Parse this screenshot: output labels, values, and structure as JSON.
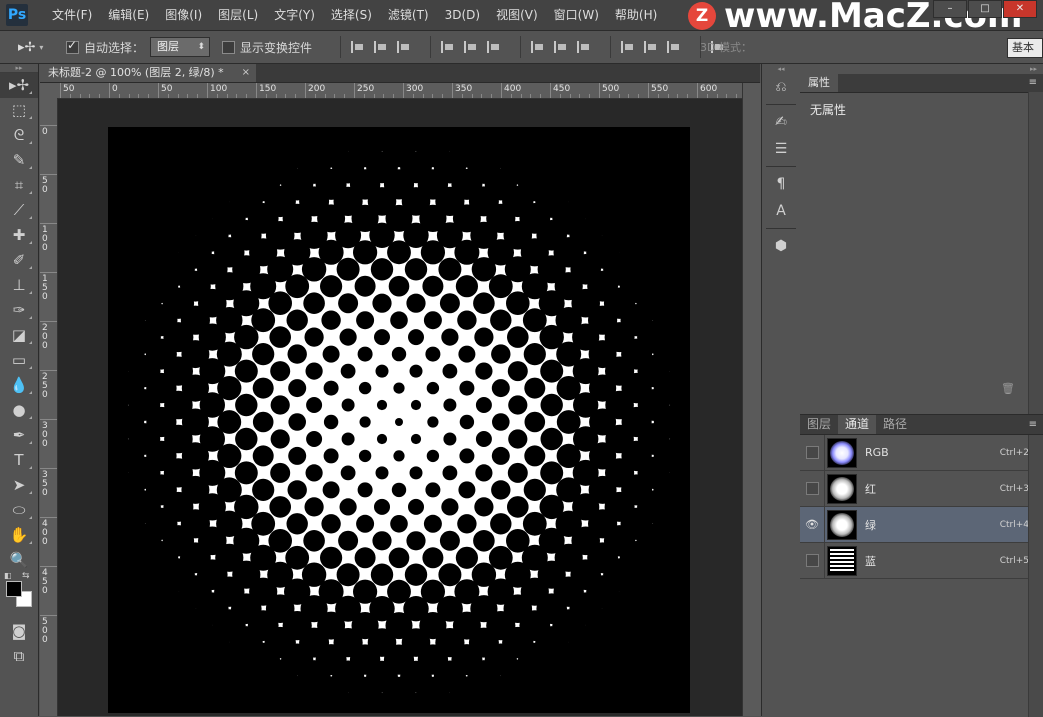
{
  "app": {
    "logo": "Ps",
    "menus": [
      "文件(F)",
      "编辑(E)",
      "图像(I)",
      "图层(L)",
      "文字(Y)",
      "选择(S)",
      "滤镜(T)",
      "3D(D)",
      "视图(V)",
      "窗口(W)",
      "帮助(H)"
    ],
    "window_controls": [
      "–",
      "□",
      "✕"
    ]
  },
  "watermark": {
    "badge": "Z",
    "text": "www.MacZ.com"
  },
  "options": {
    "auto_select_label": "自动选择：",
    "auto_select_checked": true,
    "auto_select_target": "图层",
    "show_transform_label": "显示变换控件",
    "show_transform_checked": false,
    "mode_3d_label": "3D 模式：",
    "workspace": "基本"
  },
  "tools": [
    "move-icon",
    "marquee-icon",
    "lasso-icon",
    "quick-select-icon",
    "crop-icon",
    "eyedropper-icon",
    "spot-healing-icon",
    "brush-icon",
    "clone-stamp-icon",
    "history-brush-icon",
    "eraser-icon",
    "gradient-icon",
    "blur-icon",
    "dodge-icon",
    "pen-icon",
    "type-icon",
    "path-select-icon",
    "ellipse-icon",
    "hand-icon",
    "zoom-icon"
  ],
  "colors": {
    "foreground": "#000000",
    "background": "#ffffff"
  },
  "document": {
    "tab_title": "未标题-2 @ 100% (图层 2, 绿/8) *",
    "close": "×",
    "ruler_top_labels": [
      "50",
      "0",
      "50",
      "100",
      "150",
      "200",
      "250",
      "300",
      "350",
      "400",
      "450",
      "500",
      "550",
      "600"
    ],
    "ruler_left_labels": [
      "0",
      "5\n0",
      "1\n0\n0",
      "1\n5\n0",
      "2\n0\n0",
      "2\n5\n0",
      "3\n0\n0",
      "3\n5\n0",
      "4\n0\n0",
      "4\n5\n0",
      "5\n0\n0"
    ]
  },
  "side_icons": [
    "history-icon",
    "brush-presets-icon",
    "adjust-icon",
    "character-icon",
    "paragraph-icon",
    "3d-cube-icon"
  ],
  "properties": {
    "tab": "属性",
    "empty_text": "无属性",
    "menu_glyph": "≡"
  },
  "channels": {
    "tabs": [
      "图层",
      "通道",
      "路径"
    ],
    "active_tab": "通道",
    "rows": [
      {
        "name": "RGB",
        "shortcut": "Ctrl+2",
        "visible": false,
        "selected": false
      },
      {
        "name": "红",
        "shortcut": "Ctrl+3",
        "visible": false,
        "selected": false
      },
      {
        "name": "绿",
        "shortcut": "Ctrl+4",
        "visible": true,
        "selected": true
      },
      {
        "name": "蓝",
        "shortcut": "Ctrl+5",
        "visible": false,
        "selected": false
      }
    ]
  }
}
